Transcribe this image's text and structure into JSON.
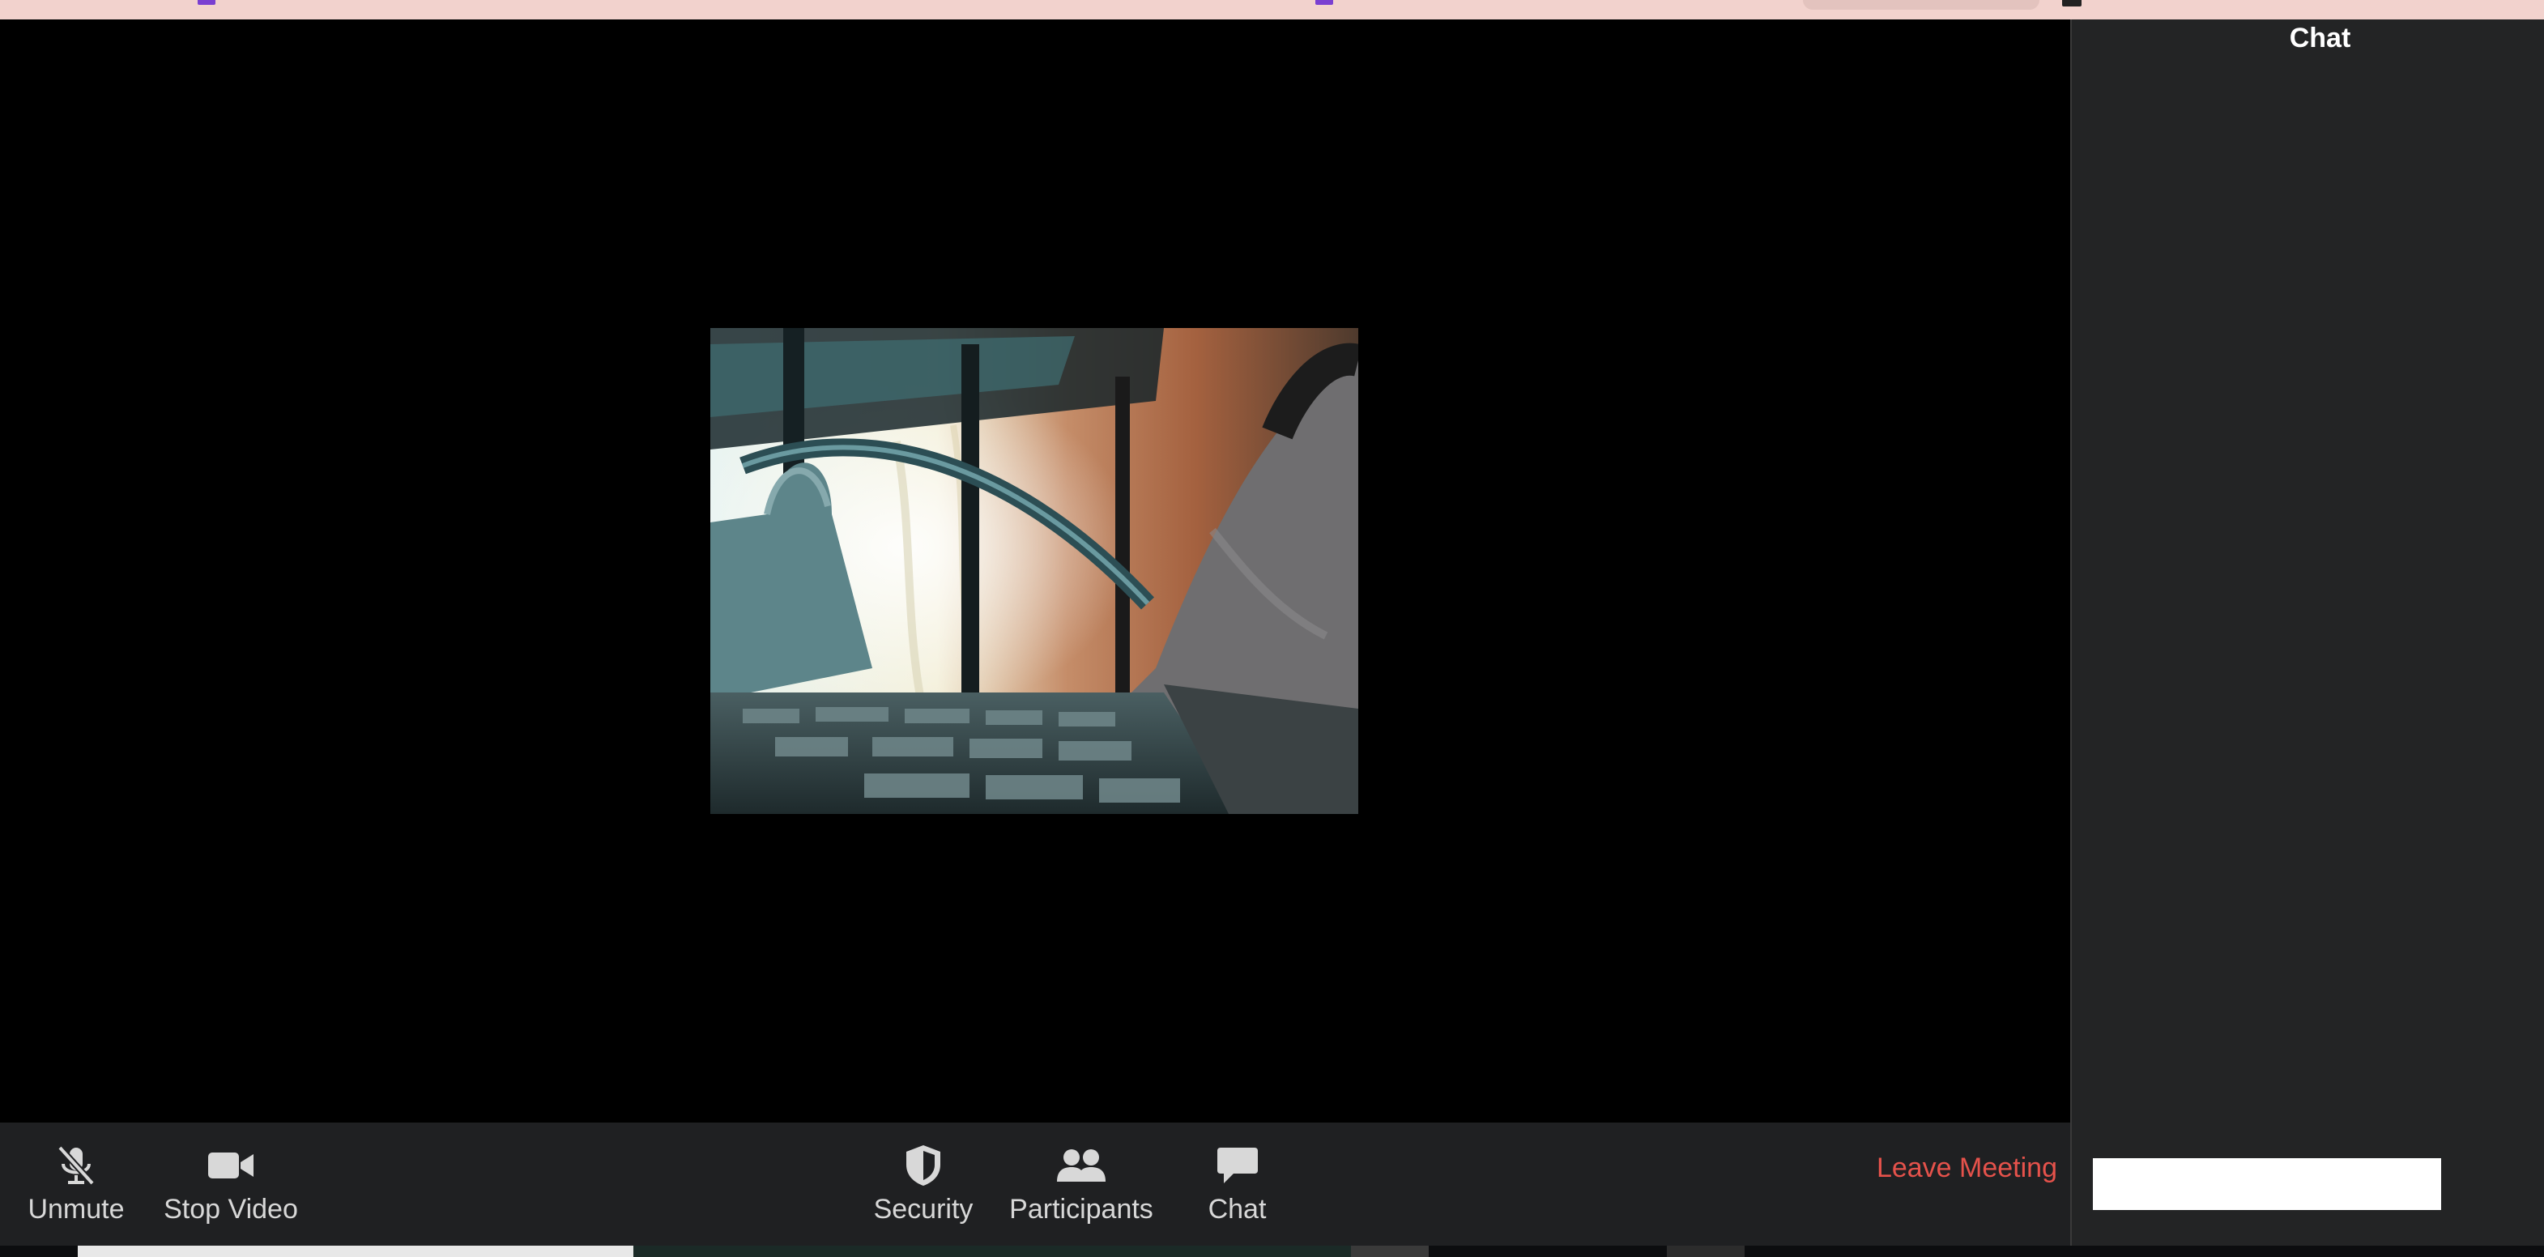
{
  "chat_panel": {
    "title": "Chat",
    "input_value": ""
  },
  "toolbar": {
    "unmute_label": "Unmute",
    "stop_video_label": "Stop Video",
    "security_label": "Security",
    "participants_label": "Participants",
    "chat_label": "Chat",
    "leave_label": "Leave Meeting"
  },
  "icons": {
    "unmute": "muted-microphone-icon",
    "stop_video": "video-camera-icon",
    "security": "shield-icon",
    "participants": "participants-icon",
    "chat": "chat-bubble-icon"
  },
  "colors": {
    "leave": "#e5524b",
    "toolbar_bg": "#1f2022",
    "panel_bg": "#232425"
  }
}
